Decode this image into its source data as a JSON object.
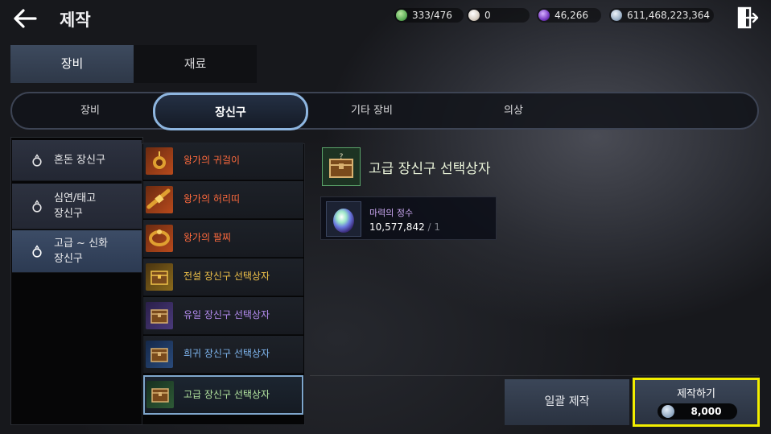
{
  "header": {
    "title": "제작",
    "back_icon": "back-arrow-icon",
    "exit_icon": "exit-door-icon",
    "currencies": [
      {
        "name": "stamina",
        "icon": "green-gem-icon",
        "value": "333/476",
        "color": "#5fae5a"
      },
      {
        "name": "pearl",
        "icon": "pearl-icon",
        "value": "0",
        "color": "#d8cfc4"
      },
      {
        "name": "purple-crystal",
        "icon": "purple-orb-icon",
        "value": "46,266",
        "color": "#7a3cc4"
      },
      {
        "name": "silver",
        "icon": "silver-coin-icon",
        "value": "611,468,223,364",
        "color": "#9fb3c9"
      }
    ]
  },
  "main_tabs": [
    {
      "label": "장비",
      "active": true
    },
    {
      "label": "재료",
      "active": false
    }
  ],
  "sub_tabs": [
    {
      "label": "장비",
      "active": false
    },
    {
      "label": "장신구",
      "active": true
    },
    {
      "label": "기타 장비",
      "active": false
    },
    {
      "label": "의상",
      "active": false
    }
  ],
  "categories": [
    {
      "label": "혼돈 장신구",
      "icon": "ring-icon",
      "selected": false
    },
    {
      "label": "심연/태고\n장신구",
      "icon": "ring-icon",
      "selected": false
    },
    {
      "label": "고급 ~ 신화\n장신구",
      "icon": "ring-icon",
      "selected": true
    }
  ],
  "items": [
    {
      "label": "왕가의 귀걸이",
      "icon": "royal-earring-icon",
      "color": "#ff6a3d",
      "grade_color": "#b84a1c",
      "selected": false
    },
    {
      "label": "왕가의 허리띠",
      "icon": "royal-belt-icon",
      "color": "#ff6a3d",
      "grade_color": "#b84a1c",
      "selected": false
    },
    {
      "label": "왕가의 팔찌",
      "icon": "royal-bracelet-icon",
      "color": "#ff6a3d",
      "grade_color": "#b84a1c",
      "selected": false
    },
    {
      "label": "전설 장신구 선택상자",
      "icon": "treasure-chest-icon",
      "color": "#f0c24a",
      "grade_color": "#8a6a1c",
      "selected": false
    },
    {
      "label": "유일 장신구 선택상자",
      "icon": "treasure-chest-icon",
      "color": "#b48cf0",
      "grade_color": "#4a3a7a",
      "selected": false
    },
    {
      "label": "희귀 장신구 선택상자",
      "icon": "treasure-chest-icon",
      "color": "#7fb6f0",
      "grade_color": "#2a4a7a",
      "selected": false
    },
    {
      "label": "고급 장신구 선택상자",
      "icon": "treasure-chest-icon",
      "color": "#b4e6a0",
      "grade_color": "#2e5a36",
      "selected": true
    }
  ],
  "detail": {
    "title": "고급 장신구 선택상자",
    "icon": "treasure-chest-icon",
    "material": {
      "name": "마력의 정수",
      "icon": "magic-essence-orb-icon",
      "owned": "10,577,842",
      "required": " / 1"
    }
  },
  "actions": {
    "bulk_label": "일괄 제작",
    "craft_label": "제작하기",
    "craft_cost": "8,000",
    "craft_cost_icon": "silver-coin-icon",
    "highlight_color": "#f2ee00"
  }
}
